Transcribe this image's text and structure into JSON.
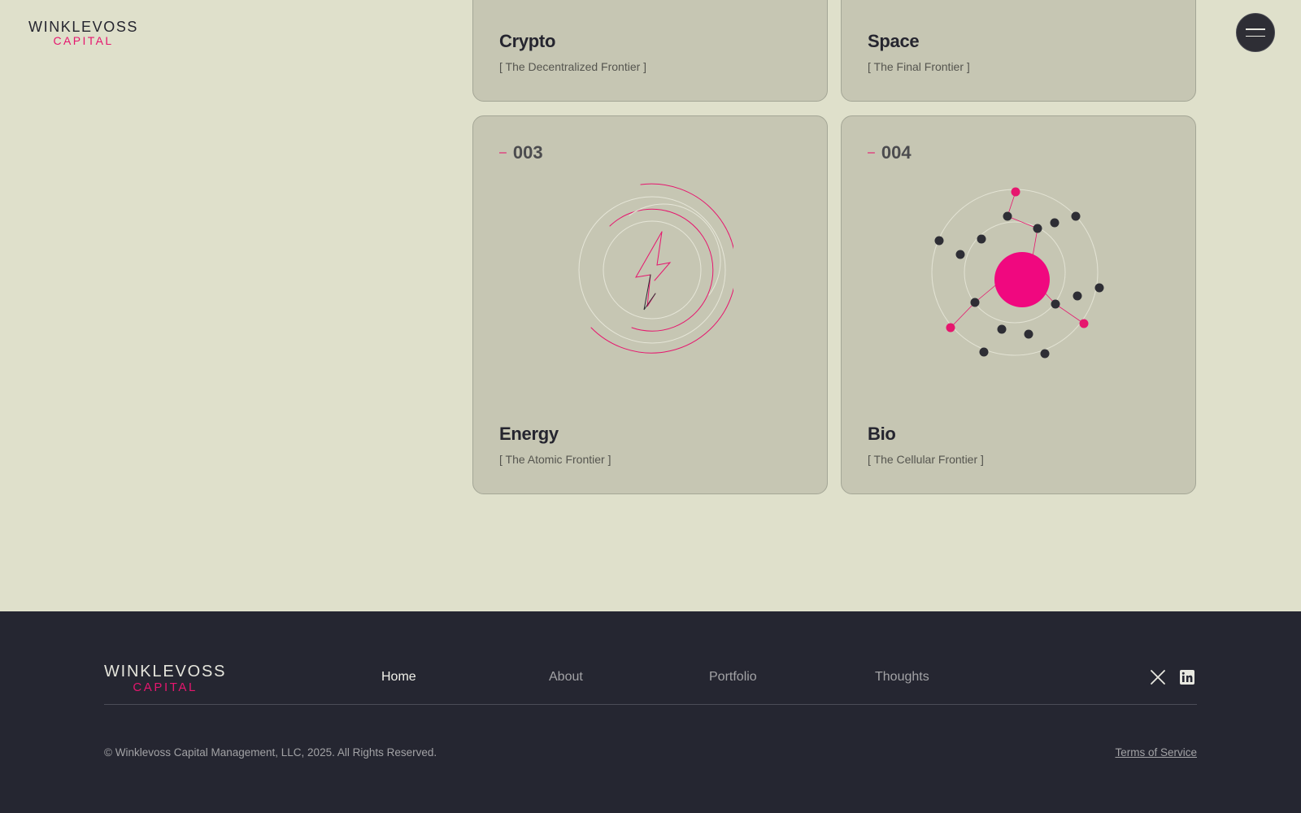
{
  "colors": {
    "accent": "#e6166e",
    "page_bg": "#dfe0cb",
    "card_bg": "#c6c6b3",
    "footer_bg": "#252631"
  },
  "header": {
    "logo_line1": "WINKLEVOSS",
    "logo_line2": "CAPITAL",
    "menu_icon": "hamburger-icon"
  },
  "cards": [
    {
      "id": "crypto",
      "title": "Crypto",
      "subtitle": "[ The Decentralized Frontier ]"
    },
    {
      "id": "space",
      "title": "Space",
      "subtitle": "[ The Final Frontier ]"
    },
    {
      "id": "energy",
      "number": "003",
      "title": "Energy",
      "subtitle": "[ The Atomic Frontier ]",
      "icon": "lightning-bolt-icon"
    },
    {
      "id": "bio",
      "number": "004",
      "title": "Bio",
      "subtitle": "[ The Cellular Frontier ]",
      "icon": "cell-network-icon"
    }
  ],
  "footer": {
    "logo_line1": "WINKLEVOSS",
    "logo_line2": "CAPITAL",
    "nav": [
      {
        "label": "Home",
        "active": true
      },
      {
        "label": "About"
      },
      {
        "label": "Portfolio"
      },
      {
        "label": "Thoughts"
      }
    ],
    "social": [
      "x-icon",
      "linkedin-icon"
    ],
    "copyright": "© Winklevoss Capital Management, LLC, 2025. All Rights Reserved.",
    "terms_label": "Terms of Service"
  }
}
